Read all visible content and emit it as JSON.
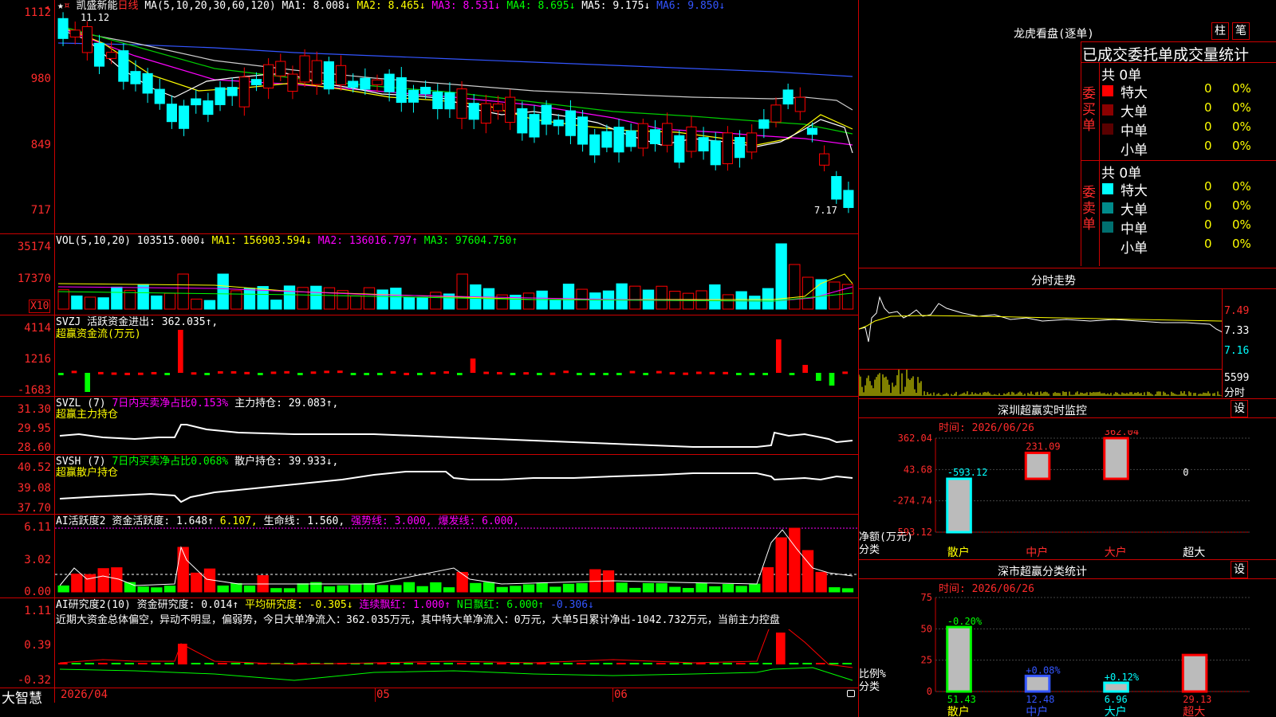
{
  "stock": {
    "name": "凯盛新能",
    "period": "日线"
  },
  "main_header": {
    "ma_def": "MA(5,10,20,30,60,120)",
    "ma1": "MA1: 8.008↓",
    "ma2": "MA2: 8.465↓",
    "ma3": "MA3: 8.531↓",
    "ma4": "MA4: 8.695↓",
    "ma5": "MA5: 9.175↓",
    "ma6": "MA6: 9.850↓",
    "high_label": "11.12",
    "low_label": "7.17"
  },
  "main_yaxis": [
    "1112",
    "980",
    "849",
    "717"
  ],
  "vol": {
    "def": "VOL(5,10,20)",
    "value": "103515.000↓",
    "ma1": "MA1: 156903.594↓",
    "ma2": "MA2: 136016.797↑",
    "ma3": "MA3: 97604.750↑",
    "yaxis": [
      "35174",
      "17370"
    ],
    "unit": "X10"
  },
  "svzj": {
    "def": "SVZJ",
    "title": "活跃资金进出: 362.035↑,",
    "sub": "超赢资金流(万元)",
    "yaxis": [
      "4114",
      "1216",
      "-1683"
    ]
  },
  "svzl": {
    "def": "SVZL (7)",
    "ratio": "7日内买卖净占比0.153%",
    "title": "主力持仓: 29.083↑,",
    "sub": "超赢主力持仓",
    "yaxis": [
      "31.30",
      "29.95",
      "28.60"
    ]
  },
  "svsh": {
    "def": "SVSH (7)",
    "ratio": "7日内买卖净占比0.068%",
    "title": "散户持仓: 39.933↓,",
    "sub": "超赢散户持仓",
    "yaxis": [
      "40.52",
      "39.08",
      "37.70"
    ]
  },
  "ai2": {
    "def": "AI活跃度2",
    "a": "资金活跃度: 1.648↑",
    "b": "6.107,",
    "c": "生命线: 1.560,",
    "d": "强势线: 3.000,",
    "e": "爆发线: 6.000,",
    "yaxis": [
      "6.11",
      "3.02",
      "0.00"
    ]
  },
  "ai_research": {
    "def": "AI研究度2(10)",
    "a": "资金研究度: 0.014↑",
    "b": "平均研究度: -0.305↓",
    "c": "连续飘红: 1.000↑",
    "d": "N日飘红: 6.000↑",
    "e": "-0.306↓",
    "comment": "近期大资金总体偏空，异动不明显，偏弱势，今日大单净流入：362.035万元，其中特大单净流入：0万元，大单5日累计净出-1042.732万元，当前主力控盘",
    "yaxis": [
      "1.11",
      "0.39",
      "-0.32"
    ]
  },
  "xaxis": {
    "d1": "2026/04",
    "d2": "05",
    "d3": "06"
  },
  "brand": "大智慧",
  "lhb": {
    "title": "龙虎看盘(逐单)",
    "tab1": "柱",
    "tab2": "笔",
    "subtitle": "已成交委托单成交量统计",
    "buy": {
      "label": "委买单",
      "total": "共 0单",
      "rows": [
        {
          "name": "特大",
          "qty": "0",
          "pct": "0%",
          "color": "#ff0000"
        },
        {
          "name": "大单",
          "qty": "0",
          "pct": "0%",
          "color": "#8b0000"
        },
        {
          "name": "中单",
          "qty": "0",
          "pct": "0%",
          "color": "#5a0000"
        },
        {
          "name": "小单",
          "qty": "0",
          "pct": "0%",
          "color": "#000000"
        }
      ]
    },
    "sell": {
      "label": "委卖单",
      "total": "共 0单",
      "rows": [
        {
          "name": "特大",
          "qty": "0",
          "pct": "0%",
          "color": "#00ffff"
        },
        {
          "name": "大单",
          "qty": "0",
          "pct": "0%",
          "color": "#008b8b"
        },
        {
          "name": "中单",
          "qty": "0",
          "pct": "0%",
          "color": "#007070"
        },
        {
          "name": "小单",
          "qty": "0",
          "pct": "0%",
          "color": "#000000"
        }
      ]
    }
  },
  "intraday": {
    "title": "分时走势",
    "y1": "7.49",
    "y2": "7.33",
    "y3": "7.16",
    "vol": "5599",
    "vol_unit": "分时"
  },
  "sz_monitor": {
    "title": "深圳超赢实时监控",
    "btn": "设",
    "time": "时间: 2026/06/26",
    "yaxis": [
      "362.04",
      "43.68",
      "-274.74",
      "-593.12"
    ],
    "ylab": "净额(万元)",
    "xlab": "分类",
    "bars": [
      {
        "cat": "散户",
        "value": -593.12,
        "label": "-593.12"
      },
      {
        "cat": "中户",
        "value": 231.09,
        "label": "231.09"
      },
      {
        "cat": "大户",
        "value": 362.04,
        "label": "362.04"
      },
      {
        "cat": "超大",
        "value": 0,
        "label": "0"
      }
    ]
  },
  "sz_class": {
    "title": "深市超赢分类统计",
    "btn": "设",
    "time": "时间: 2026/06/26",
    "yaxis": [
      "75",
      "50",
      "25",
      "0"
    ],
    "ylab": "比例%",
    "xlab": "分类",
    "bars": [
      {
        "cat": "散户",
        "value": 51.43,
        "label": "51.43",
        "chg": "-0.20%"
      },
      {
        "cat": "中户",
        "value": 12.48,
        "label": "12.48",
        "chg": "+0.08%"
      },
      {
        "cat": "大户",
        "value": 6.96,
        "label": "6.96",
        "chg": "+0.12%"
      },
      {
        "cat": "超大",
        "value": 29.13,
        "label": "29.13",
        "chg": ""
      }
    ]
  },
  "colors": {
    "up": "#ff0000",
    "down": "#00ffff",
    "grid": "#c00000"
  }
}
